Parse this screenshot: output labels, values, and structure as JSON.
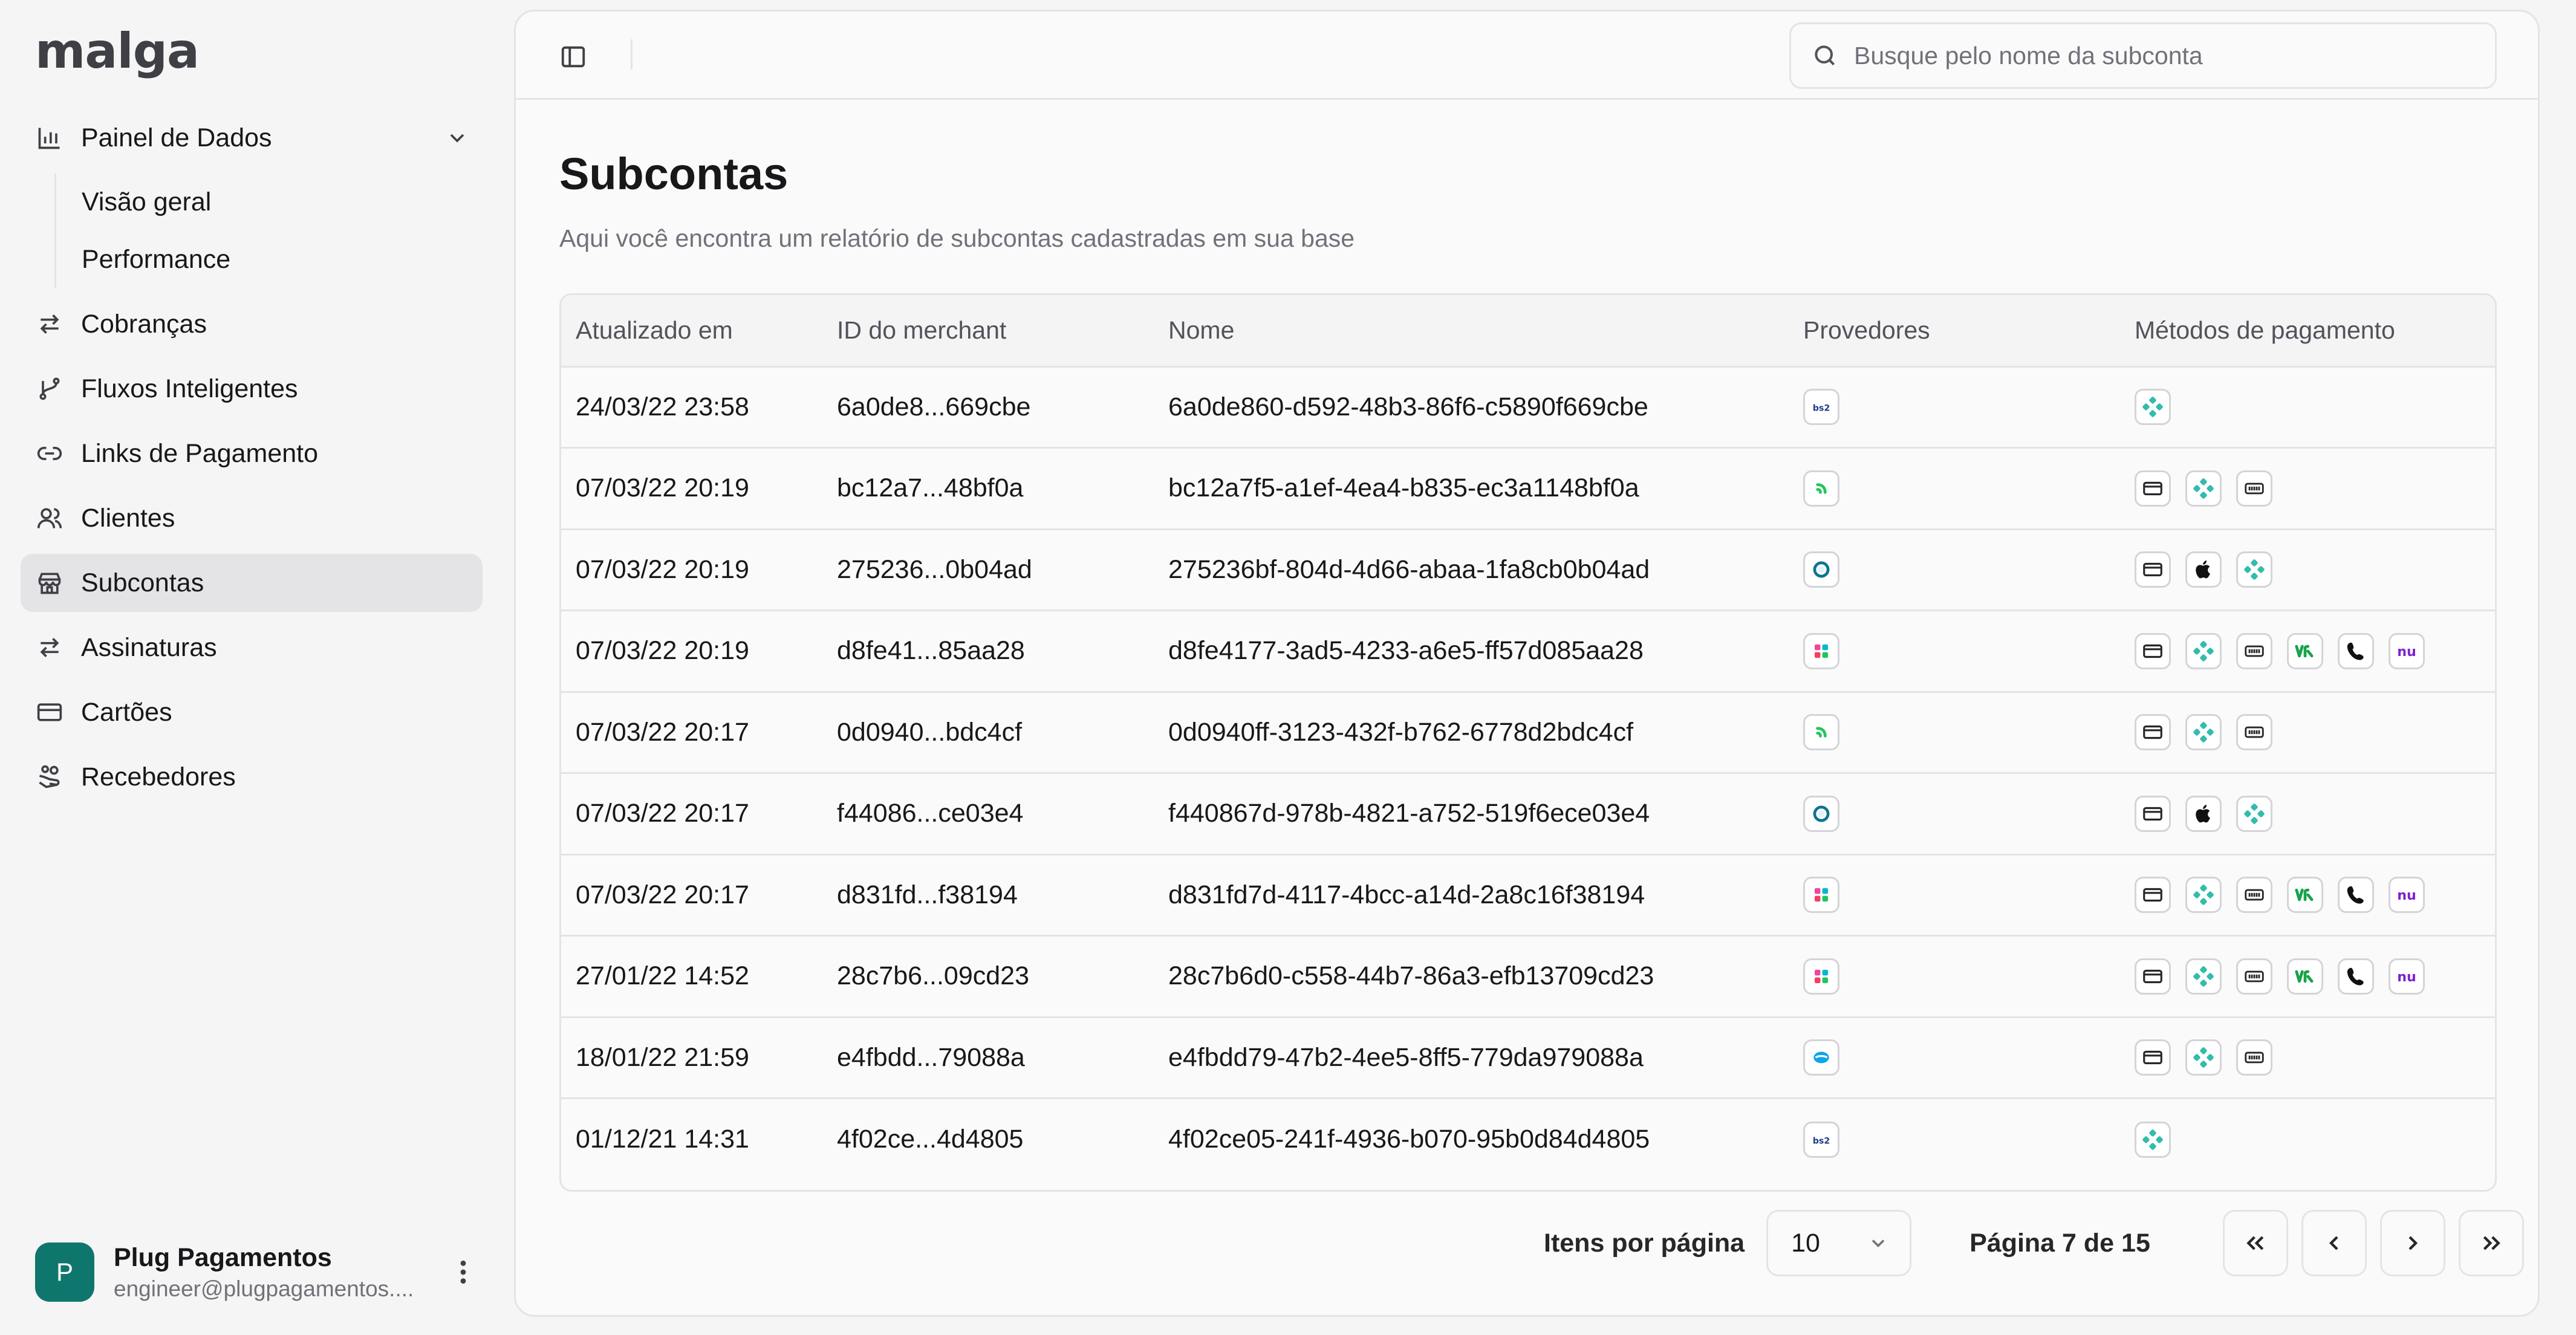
{
  "app": {
    "logo": "malga"
  },
  "sidebar": {
    "items": [
      {
        "label": "Painel de Dados",
        "icon": "bar-chart-icon",
        "expanded": true,
        "children": [
          {
            "label": "Visão geral"
          },
          {
            "label": "Performance"
          }
        ]
      },
      {
        "label": "Cobranças",
        "icon": "arrows-exchange-icon"
      },
      {
        "label": "Fluxos Inteligentes",
        "icon": "git-branch-icon"
      },
      {
        "label": "Links de Pagamento",
        "icon": "link-icon"
      },
      {
        "label": "Clientes",
        "icon": "users-icon"
      },
      {
        "label": "Subcontas",
        "icon": "store-icon",
        "active": true
      },
      {
        "label": "Assinaturas",
        "icon": "repeat-icon"
      },
      {
        "label": "Cartões",
        "icon": "credit-card-icon"
      },
      {
        "label": "Recebedores",
        "icon": "hand-coins-icon"
      }
    ],
    "profile": {
      "initial": "P",
      "name": "Plug Pagamentos",
      "email": "engineer@plugpagamentos...."
    }
  },
  "header": {
    "search_placeholder": "Busque pelo nome da subconta"
  },
  "page": {
    "title": "Subcontas",
    "subtitle": "Aqui você encontra um relatório de subcontas cadastradas em sua base"
  },
  "table": {
    "columns": [
      "Atualizado em",
      "ID do merchant",
      "Nome",
      "Provedores",
      "Métodos de pagamento"
    ],
    "rows": [
      {
        "updated": "24/03/22 23:58",
        "merchant_id": "6a0de8...669cbe",
        "name": "6a0de860-d592-48b3-86f6-c5890f669cbe",
        "provider": "bs2",
        "methods": [
          "pix"
        ]
      },
      {
        "updated": "07/03/22 20:19",
        "merchant_id": "bc12a7...48bf0a",
        "name": "bc12a7f5-a1ef-4ea4-b835-ec3a1148bf0a",
        "provider": "green",
        "methods": [
          "card",
          "pix",
          "boleto"
        ]
      },
      {
        "updated": "07/03/22 20:19",
        "merchant_id": "275236...0b04ad",
        "name": "275236bf-804d-4d66-abaa-1fa8cb0b04ad",
        "provider": "ring",
        "methods": [
          "card",
          "apple",
          "pix"
        ]
      },
      {
        "updated": "07/03/22 20:19",
        "merchant_id": "d8fe41...85aa28",
        "name": "d8fe4177-3ad5-4233-a6e5-ff57d085aa28",
        "provider": "multi",
        "methods": [
          "card",
          "pix",
          "boleto",
          "vr",
          "picpay",
          "nu"
        ]
      },
      {
        "updated": "07/03/22 20:17",
        "merchant_id": "0d0940...bdc4cf",
        "name": "0d0940ff-3123-432f-b762-6778d2bdc4cf",
        "provider": "green",
        "methods": [
          "card",
          "pix",
          "boleto"
        ]
      },
      {
        "updated": "07/03/22 20:17",
        "merchant_id": "f44086...ce03e4",
        "name": "f440867d-978b-4821-a752-519f6ece03e4",
        "provider": "ring",
        "methods": [
          "card",
          "apple",
          "pix"
        ]
      },
      {
        "updated": "07/03/22 20:17",
        "merchant_id": "d831fd...f38194",
        "name": "d831fd7d-4117-4bcc-a14d-2a8c16f38194",
        "provider": "multi",
        "methods": [
          "card",
          "pix",
          "boleto",
          "vr",
          "picpay",
          "nu"
        ]
      },
      {
        "updated": "27/01/22 14:52",
        "merchant_id": "28c7b6...09cd23",
        "name": "28c7b6d0-c558-44b7-86a3-efb13709cd23",
        "provider": "multi",
        "methods": [
          "card",
          "pix",
          "boleto",
          "vr",
          "picpay",
          "nu"
        ]
      },
      {
        "updated": "18/01/22 21:59",
        "merchant_id": "e4fbdd...79088a",
        "name": "e4fbdd79-47b2-4ee5-8ff5-779da979088a",
        "provider": "blue",
        "methods": [
          "card",
          "pix",
          "boleto"
        ]
      },
      {
        "updated": "01/12/21 14:31",
        "merchant_id": "4f02ce...4d4805",
        "name": "4f02ce05-241f-4936-b070-95b0d84d4805",
        "provider": "bs2",
        "methods": [
          "pix"
        ]
      }
    ]
  },
  "pagination": {
    "items_per_page_label": "Itens por página",
    "items_per_page": "10",
    "page_info": "Página 7 de 15"
  },
  "colors": {
    "pix": "#32bcad",
    "vr": "#16a34a",
    "nu": "#7e22ce",
    "bs2": "#1e3a8a",
    "avatar": "#0f766e"
  }
}
